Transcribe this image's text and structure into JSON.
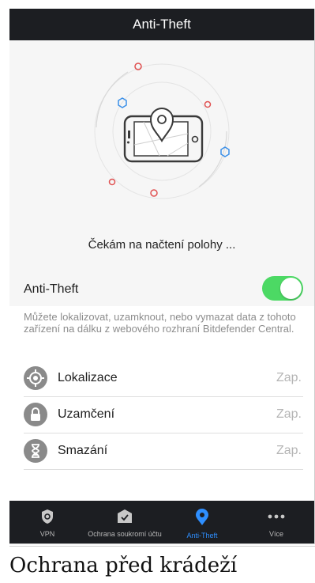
{
  "header": {
    "title": "Anti-Theft"
  },
  "hero": {
    "status_text": "Čekám na načtení polohy ...",
    "icon": "phone-location-pin-icon"
  },
  "antitheft": {
    "toggle_label": "Anti-Theft",
    "toggle_on": true,
    "description": "Můžete lokalizovat, uzamknout, nebo vymazat data z tohoto zařízení na dálku z webového rozhraní Bitdefender Central."
  },
  "features": [
    {
      "label": "Lokalizace",
      "value": "Zap.",
      "icon": "locate-target-icon"
    },
    {
      "label": "Uzamčení",
      "value": "Zap.",
      "icon": "lock-icon"
    },
    {
      "label": "Smazání",
      "value": "Zap.",
      "icon": "wipe-hourglass-icon"
    }
  ],
  "tabs": [
    {
      "label": "VPN",
      "icon": "vpn-shield-icon",
      "active": false
    },
    {
      "label": "Ochrana soukromí účtu",
      "icon": "account-privacy-icon",
      "active": false
    },
    {
      "label": "Anti-Theft",
      "icon": "location-pin-icon",
      "active": true
    },
    {
      "label": "Více",
      "icon": "more-dots-icon",
      "active": false
    }
  ],
  "caption": "Ochrana před krádeží",
  "colors": {
    "accent": "#2e8fff",
    "toggle_on": "#4cd964",
    "bar": "#1c1e22"
  }
}
